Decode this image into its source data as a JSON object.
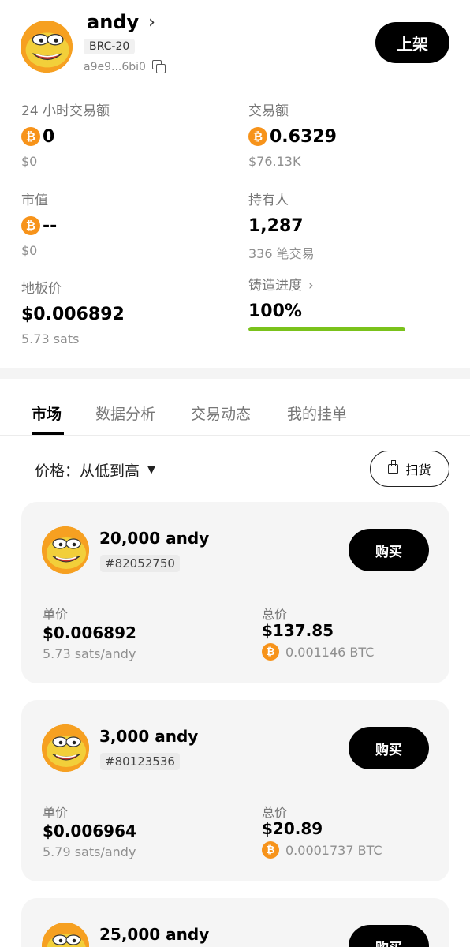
{
  "token": {
    "name": "andy",
    "standard": "BRC-20",
    "address": "a9e9...6bi0",
    "list_button": "上架",
    "avatar_icon": "pepe-meme-avatar-icon"
  },
  "stats": {
    "volume_24h": {
      "label": "24 小时交易额",
      "value": "0",
      "usd": "$0"
    },
    "volume_total": {
      "label": "交易额",
      "value": "0.6329",
      "usd": "$76.13K"
    },
    "market_cap": {
      "label": "市值",
      "value": "--",
      "usd": "$0"
    },
    "holders": {
      "label": "持有人",
      "value": "1,287",
      "sub": "336 笔交易"
    },
    "floor_price": {
      "label": "地板价",
      "value": "$0.006892",
      "sub": "5.73 sats"
    },
    "mint_progress": {
      "label": "铸造进度",
      "value": "100%",
      "fraction": 1.0
    }
  },
  "btc_symbol": "₿",
  "tabs": [
    {
      "label": "市场",
      "active": true
    },
    {
      "label": "数据分析",
      "active": false
    },
    {
      "label": "交易动态",
      "active": false
    },
    {
      "label": "我的挂单",
      "active": false
    }
  ],
  "sort": {
    "label": "价格：从低到高"
  },
  "sweep_button": "扫货",
  "listings": [
    {
      "quantity": "20,000 andy",
      "inscription": "#82052750",
      "buy_label": "购买",
      "unit_label": "单价",
      "unit_price": "$0.006892",
      "unit_sats": "5.73 sats/andy",
      "total_label": "总价",
      "total_usd": "$137.85",
      "total_btc": "0.001146 BTC"
    },
    {
      "quantity": "3,000 andy",
      "inscription": "#80123536",
      "buy_label": "购买",
      "unit_label": "单价",
      "unit_price": "$0.006964",
      "unit_sats": "5.79 sats/andy",
      "total_label": "总价",
      "total_usd": "$20.89",
      "total_btc": "0.0001737 BTC"
    },
    {
      "quantity": "25,000 andy",
      "buy_label": "购买"
    }
  ],
  "colors": {
    "accent_green": "#7ac21b",
    "btc_orange": "#f7931a",
    "avatar_orange": "#f6a021"
  }
}
